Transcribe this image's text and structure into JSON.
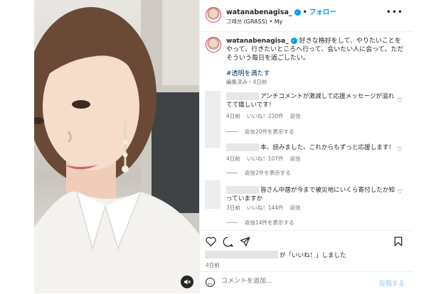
{
  "header": {
    "username": "watanabenagisa_",
    "verified_mark": "✓",
    "separator": "•",
    "follow_label": "フォロー",
    "audio": "그래쓰 (GRASS) • My",
    "more_icon": "more-icon"
  },
  "caption": {
    "username": "watanabenagisa_",
    "text": "好きな格好をして、やりたいことをやって、行きたいところへ行って、会いたい人に会って。ただそういう毎日を過ごしたい。",
    "hashtag": "#透明を満たす",
    "edited": "編集済み・4日前"
  },
  "comments": [
    {
      "text": "アンチコメントが激減して応援メッセージが溢れてて嬉しいです！",
      "time": "4日前",
      "likes": "いいね！230件",
      "reply": "返信",
      "replies": "返信20件を表示する"
    },
    {
      "text": "本、読みました。これからもずっと応援します!",
      "time": "4日前",
      "likes": "いいね！107件",
      "reply": "返信",
      "replies": "返信2件を表示する"
    },
    {
      "text": "皆さん中居が今まで被災地にいくら寄付したか知っていますか",
      "time": "3日前",
      "likes": "いいね！144件",
      "reply": "返信",
      "replies": "返信14件を表示する"
    }
  ],
  "likes_line": "が「いいね！」しました",
  "post_date": "4日前",
  "comment_box": {
    "placeholder": "コメントを追加...",
    "post_label": "投稿する"
  },
  "colors": {
    "accent": "#0095f6",
    "text": "#262626",
    "muted": "#737373",
    "hashtag": "#00376b"
  }
}
